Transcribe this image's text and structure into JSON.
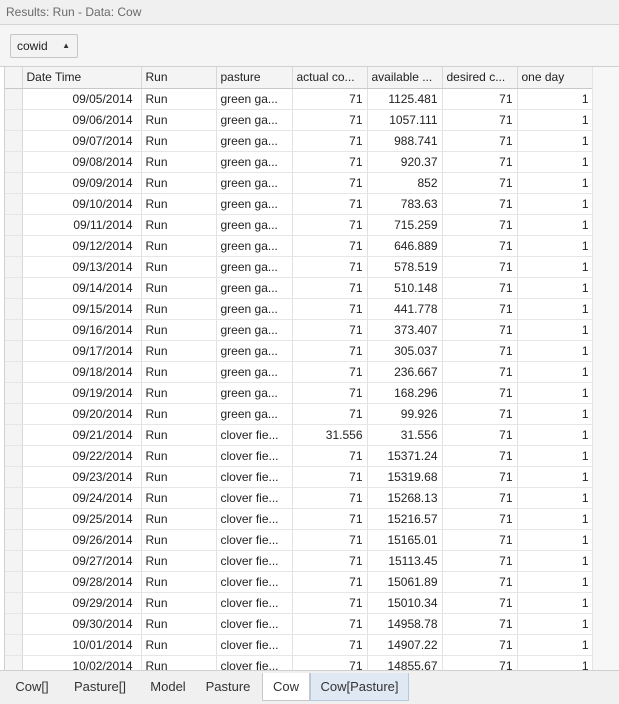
{
  "window": {
    "title": "Results: Run - Data: Cow"
  },
  "group": {
    "label": "cowid"
  },
  "columns": [
    "Date Time",
    "Run",
    "pasture",
    "actual co...",
    "available ...",
    "desired c...",
    "one day"
  ],
  "rows": [
    [
      "09/05/2014",
      "Run",
      "green ga...",
      "71",
      "1125.481",
      "71",
      "1"
    ],
    [
      "09/06/2014",
      "Run",
      "green ga...",
      "71",
      "1057.111",
      "71",
      "1"
    ],
    [
      "09/07/2014",
      "Run",
      "green ga...",
      "71",
      "988.741",
      "71",
      "1"
    ],
    [
      "09/08/2014",
      "Run",
      "green ga...",
      "71",
      "920.37",
      "71",
      "1"
    ],
    [
      "09/09/2014",
      "Run",
      "green ga...",
      "71",
      "852",
      "71",
      "1"
    ],
    [
      "09/10/2014",
      "Run",
      "green ga...",
      "71",
      "783.63",
      "71",
      "1"
    ],
    [
      "09/11/2014",
      "Run",
      "green ga...",
      "71",
      "715.259",
      "71",
      "1"
    ],
    [
      "09/12/2014",
      "Run",
      "green ga...",
      "71",
      "646.889",
      "71",
      "1"
    ],
    [
      "09/13/2014",
      "Run",
      "green ga...",
      "71",
      "578.519",
      "71",
      "1"
    ],
    [
      "09/14/2014",
      "Run",
      "green ga...",
      "71",
      "510.148",
      "71",
      "1"
    ],
    [
      "09/15/2014",
      "Run",
      "green ga...",
      "71",
      "441.778",
      "71",
      "1"
    ],
    [
      "09/16/2014",
      "Run",
      "green ga...",
      "71",
      "373.407",
      "71",
      "1"
    ],
    [
      "09/17/2014",
      "Run",
      "green ga...",
      "71",
      "305.037",
      "71",
      "1"
    ],
    [
      "09/18/2014",
      "Run",
      "green ga...",
      "71",
      "236.667",
      "71",
      "1"
    ],
    [
      "09/19/2014",
      "Run",
      "green ga...",
      "71",
      "168.296",
      "71",
      "1"
    ],
    [
      "09/20/2014",
      "Run",
      "green ga...",
      "71",
      "99.926",
      "71",
      "1"
    ],
    [
      "09/21/2014",
      "Run",
      "clover fie...",
      "31.556",
      "31.556",
      "71",
      "1"
    ],
    [
      "09/22/2014",
      "Run",
      "clover fie...",
      "71",
      "15371.24",
      "71",
      "1"
    ],
    [
      "09/23/2014",
      "Run",
      "clover fie...",
      "71",
      "15319.68",
      "71",
      "1"
    ],
    [
      "09/24/2014",
      "Run",
      "clover fie...",
      "71",
      "15268.13",
      "71",
      "1"
    ],
    [
      "09/25/2014",
      "Run",
      "clover fie...",
      "71",
      "15216.57",
      "71",
      "1"
    ],
    [
      "09/26/2014",
      "Run",
      "clover fie...",
      "71",
      "15165.01",
      "71",
      "1"
    ],
    [
      "09/27/2014",
      "Run",
      "clover fie...",
      "71",
      "15113.45",
      "71",
      "1"
    ],
    [
      "09/28/2014",
      "Run",
      "clover fie...",
      "71",
      "15061.89",
      "71",
      "1"
    ],
    [
      "09/29/2014",
      "Run",
      "clover fie...",
      "71",
      "15010.34",
      "71",
      "1"
    ],
    [
      "09/30/2014",
      "Run",
      "clover fie...",
      "71",
      "14958.78",
      "71",
      "1"
    ],
    [
      "10/01/2014",
      "Run",
      "clover fie...",
      "71",
      "14907.22",
      "71",
      "1"
    ],
    [
      "10/02/2014",
      "Run",
      "clover fie...",
      "71",
      "14855.67",
      "71",
      "1"
    ]
  ],
  "tabs": [
    "Cow[]",
    "Pasture[]",
    "Model",
    "Pasture",
    "Cow",
    "Cow[Pasture]"
  ],
  "active_tab": "Cow"
}
